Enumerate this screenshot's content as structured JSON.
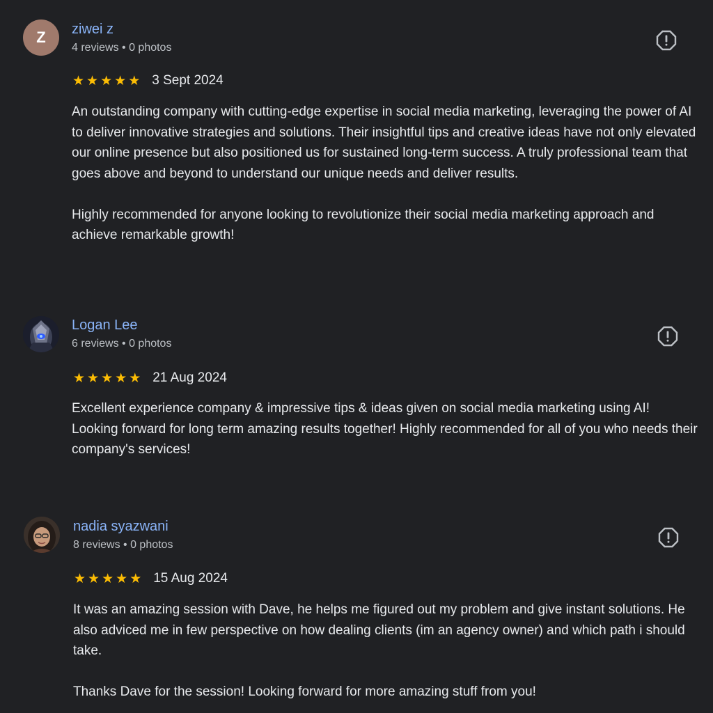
{
  "reviews": [
    {
      "avatar_letter": "Z",
      "avatar_color": "#a07a6c",
      "name": "ziwei z",
      "meta": "4 reviews • 0 photos",
      "rating": 5,
      "stars": [
        "★",
        "★",
        "★",
        "★",
        "★"
      ],
      "date": "3 Sept 2024",
      "paragraphs": [
        "An outstanding company with cutting-edge expertise in social media marketing, leveraging the power of AI to deliver innovative strategies and solutions. Their insightful tips and creative ideas have not only elevated our online presence but also positioned us for sustained long-term success. A truly professional team that goes above and beyond to understand our unique needs and deliver results.",
        "Highly recommended for anyone looking to revolutionize their social media marketing approach and achieve remarkable growth!"
      ]
    },
    {
      "avatar_icon": "robot-avatar-icon",
      "name": "Logan Lee",
      "meta": "6 reviews • 0 photos",
      "rating": 5,
      "stars": [
        "★",
        "★",
        "★",
        "★",
        "★"
      ],
      "date": "21 Aug 2024",
      "paragraphs": [
        "Excellent experience company & impressive tips & ideas given on social media marketing using AI! Looking forward for long term amazing results together! Highly recommended for all of you who needs their company's services!"
      ]
    },
    {
      "avatar_icon": "person-photo-avatar-icon",
      "name": "nadia syazwani",
      "meta": "8 reviews • 0 photos",
      "rating": 5,
      "stars": [
        "★",
        "★",
        "★",
        "★",
        "★"
      ],
      "date": "15 Aug 2024",
      "paragraphs": [
        "It was an amazing session with Dave, he helps me figured out my problem and give instant solutions. He also adviced me in few perspective on how dealing clients (im an agency owner) and which path i should take.",
        "Thanks Dave for the session! Looking forward for more amazing stuff from you!"
      ]
    }
  ],
  "colors": {
    "background": "#202124",
    "reviewer_name": "#8ab4f8",
    "star": "#fbbc04",
    "text": "#e8eaed",
    "meta_text": "#bdc1c6"
  },
  "icons": {
    "report": "report-flag-icon",
    "star": "star-icon"
  }
}
